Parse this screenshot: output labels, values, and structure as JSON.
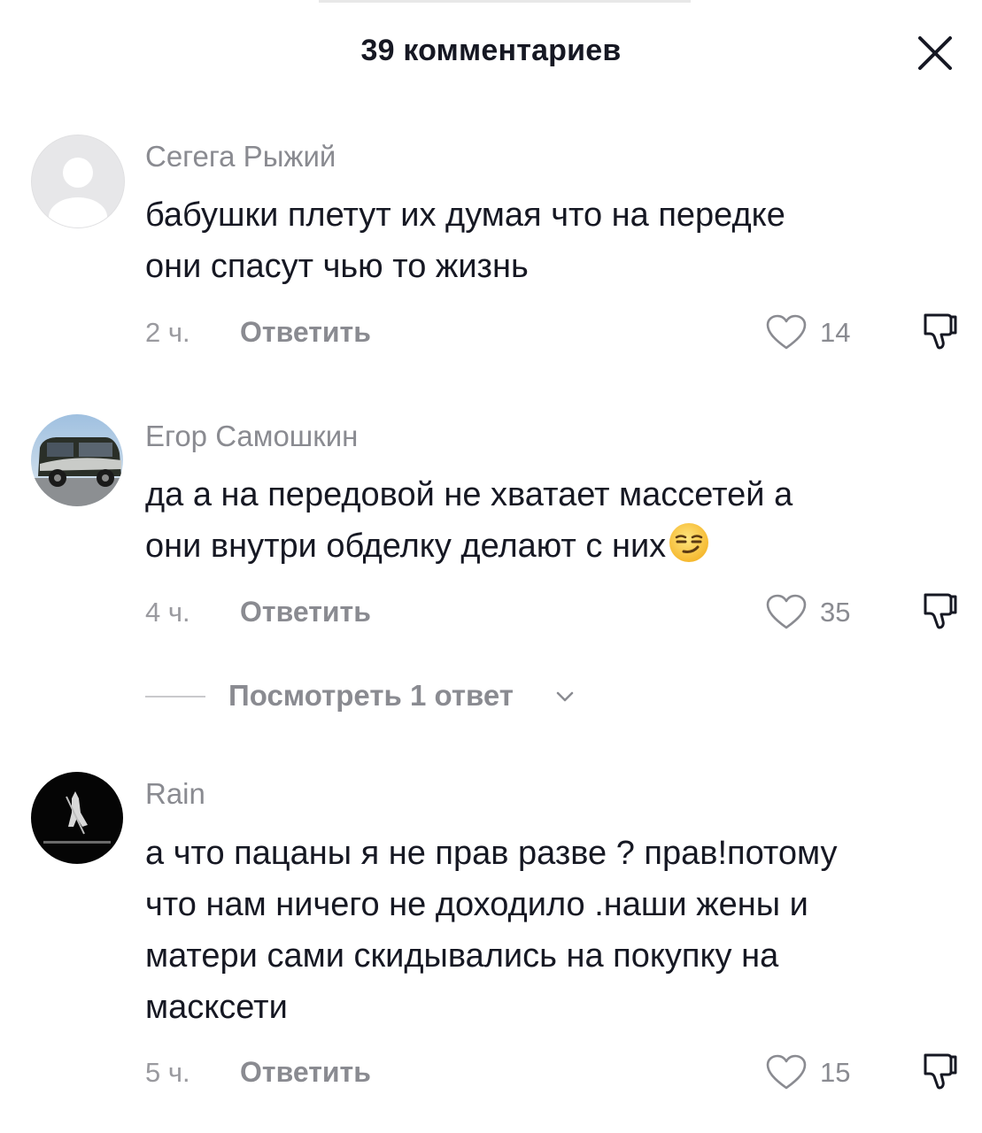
{
  "header": {
    "title": "39 комментариев"
  },
  "comments": [
    {
      "username": "Сегега Рыжий",
      "lines": [
        "бабушки плетут их думая что на передке",
        "они спасут чью то жизнь"
      ],
      "time": "2 ч.",
      "reply_label": "Ответить",
      "likes": "14",
      "avatar": "default-avatar-icon"
    },
    {
      "username": "Егор Самошкин",
      "lines": [
        "да а на передовой не хватает массетей а",
        "они внутри обделку делают с них"
      ],
      "emoji": "smirking-face",
      "time": "4 ч.",
      "reply_label": "Ответить",
      "likes": "35",
      "avatar": "car-photo",
      "view_replies_label": "Посмотреть 1 ответ"
    },
    {
      "username": "Rain",
      "lines": [
        "а что пацаны я не прав разве ? прав!потому",
        "что нам ничего не доходило .наши жены и",
        "матери сами скидывались на покупку на",
        "масксети"
      ],
      "time": "5 ч.",
      "reply_label": "Ответить",
      "likes": "15",
      "avatar": "dark-figure-photo"
    }
  ],
  "colors": {
    "text": "#161823",
    "secondary": "#8a8b91",
    "background": "#ffffff"
  }
}
